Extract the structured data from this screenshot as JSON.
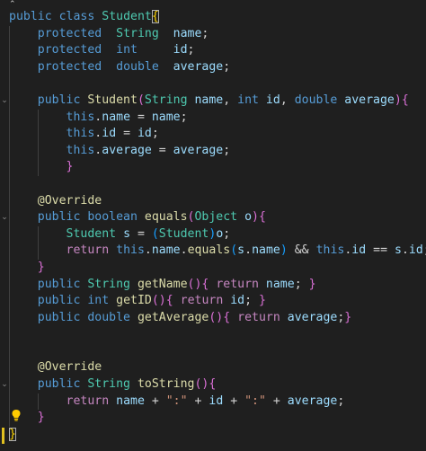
{
  "editor": {
    "language": "java",
    "theme_colors": {
      "background": "#1f1f1f",
      "keyword": "#569cd6",
      "control_keyword": "#c586c0",
      "type": "#4ec9b0",
      "function": "#dcdcaa",
      "variable": "#9cdcfe",
      "string": "#ce9178",
      "bracket_level1": "#ffd700",
      "bracket_level2": "#da70d6",
      "bracket_level3": "#179fff"
    },
    "lightbulb_icon": "lightbulb-icon",
    "fold_icon": "chevron-down-icon"
  },
  "code": {
    "l1": {
      "public": "public",
      "class": "class",
      "name": "Student",
      "brace": "{"
    },
    "l2": {
      "mod": "protected",
      "type": "String",
      "name": "name",
      "semi": ";"
    },
    "l3": {
      "mod": "protected",
      "type": "int",
      "name": "id",
      "semi": ";"
    },
    "l4": {
      "mod": "protected",
      "type": "double",
      "name": "average",
      "semi": ";"
    },
    "l6": {
      "public": "public",
      "ctor": "Student",
      "p1type": "String",
      "p1": "name",
      "p2type": "int",
      "p2": "id",
      "p3type": "double",
      "p3": "average"
    },
    "l7": {
      "this": "this",
      "field": "name",
      "value": "name"
    },
    "l8": {
      "this": "this",
      "field": "id",
      "value": "id"
    },
    "l9": {
      "this": "this",
      "field": "average",
      "value": "average"
    },
    "l10": {
      "brace": "}"
    },
    "l12": {
      "annotation": "@Override"
    },
    "l13": {
      "public": "public",
      "type": "boolean",
      "fn": "equals",
      "ptype": "Object",
      "param": "o"
    },
    "l14": {
      "type": "Student",
      "var": "s",
      "cast": "Student",
      "src": "o"
    },
    "l15": {
      "ret": "return",
      "this1": "this",
      "f1": "name",
      "call": "equals",
      "s1": "s",
      "f2": "name",
      "and": "&&",
      "this2": "this",
      "f3": "id",
      "eq": "==",
      "s2": "s",
      "f4": "id"
    },
    "l16": {
      "brace": "}"
    },
    "l17": {
      "public": "public",
      "type": "String",
      "fn": "getName",
      "ret": "return",
      "val": "name"
    },
    "l18": {
      "public": "public",
      "type": "int",
      "fn": "getID",
      "ret": "return",
      "val": "id"
    },
    "l19": {
      "public": "public",
      "type": "double",
      "fn": "getAverage",
      "ret": "return",
      "val": "average"
    },
    "l22": {
      "annotation": "@Override"
    },
    "l23": {
      "public": "public",
      "type": "String",
      "fn": "toString"
    },
    "l24": {
      "ret": "return",
      "v1": "name",
      "s1": "\":\"",
      "v2": "id",
      "s2": "\":\"",
      "v3": "average"
    },
    "l25": {
      "brace": "}"
    },
    "l26": {
      "brace": "}"
    }
  }
}
